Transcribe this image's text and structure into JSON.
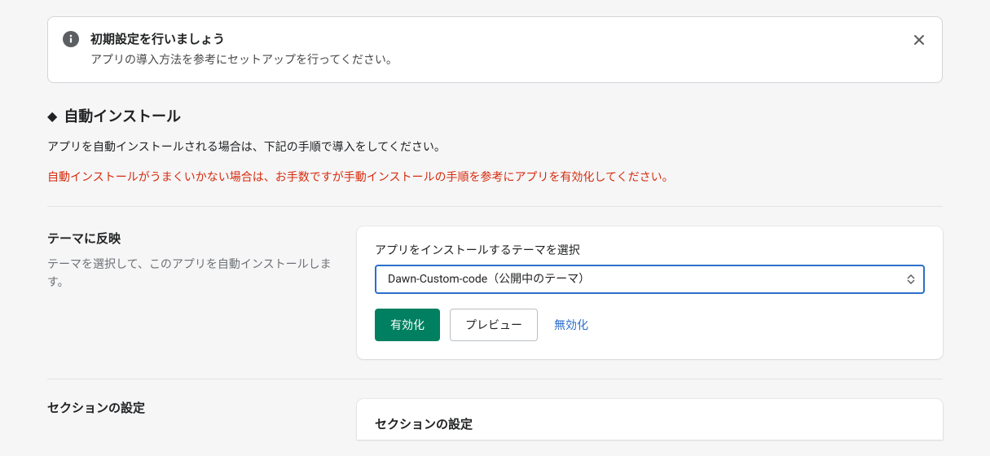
{
  "banner": {
    "title": "初期設定を行いましょう",
    "desc": "アプリの導入方法を参考にセットアップを行ってください。"
  },
  "auto_install": {
    "heading": "自動インストール",
    "desc": "アプリを自動インストールされる場合は、下記の手順で導入をしてください。",
    "warning": "自動インストールがうまくいかない場合は、お手数ですが手動インストールの手順を参考にアプリを有効化してください。"
  },
  "theme_reflect": {
    "title": "テーマに反映",
    "desc": "テーマを選択して、このアプリを自動インストールします。",
    "select_label": "アプリをインストールするテーマを選択",
    "selected_option": "Dawn-Custom-code（公開中のテーマ）",
    "enable_btn": "有効化",
    "preview_btn": "プレビュー",
    "disable_btn": "無効化"
  },
  "section_settings": {
    "left_title": "セクションの設定",
    "card_title": "セクションの設定"
  }
}
